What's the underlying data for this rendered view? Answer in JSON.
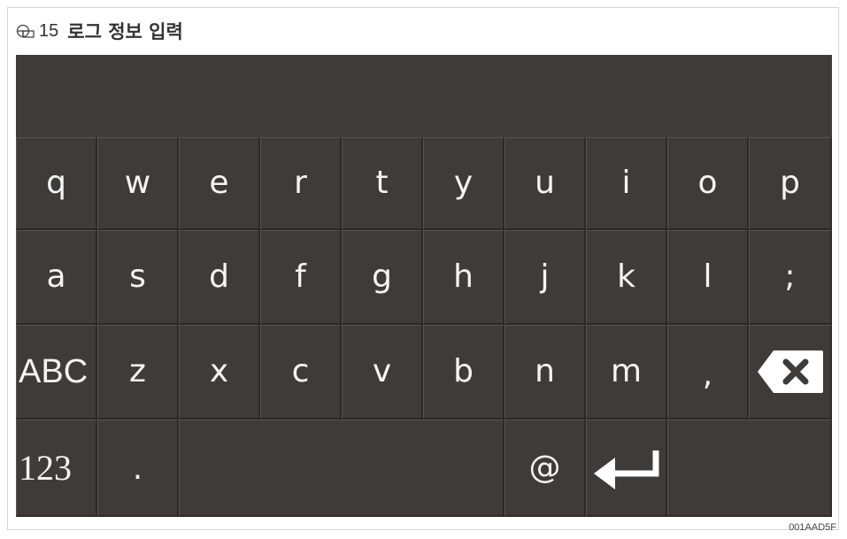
{
  "figure": {
    "number": "15",
    "title": "로그 정보 입력",
    "code": "001AAD5F",
    "icon": "figure-icon"
  },
  "keyboard": {
    "row1": [
      "q",
      "w",
      "e",
      "r",
      "t",
      "y",
      "u",
      "i",
      "o",
      "p"
    ],
    "row2": [
      "a",
      "s",
      "d",
      "f",
      "g",
      "h",
      "j",
      "k",
      "l",
      ";"
    ],
    "row3": [
      "ABC",
      "z",
      "x",
      "c",
      "v",
      "b",
      "n",
      "m",
      ","
    ],
    "row4": [
      "123",
      ".",
      "@"
    ],
    "backspace_icon": "backspace-icon",
    "enter_icon": "enter-icon",
    "colors": {
      "background": "#3f3b38",
      "key_text": "#f4f4f4"
    }
  }
}
